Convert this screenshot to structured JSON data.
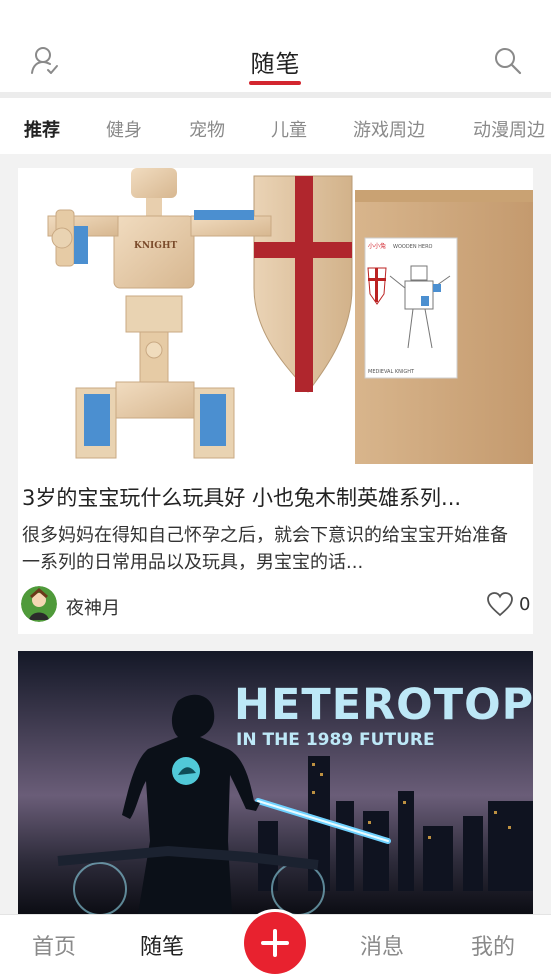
{
  "header": {
    "title": "随笔"
  },
  "icons": {
    "user": "user-check-icon",
    "search": "search-icon",
    "like": "heart-outline-icon",
    "add": "plus-icon"
  },
  "colors": {
    "accent": "#d3262f",
    "add_button": "#e8222f"
  },
  "tabs": [
    {
      "label": "推荐",
      "active": true
    },
    {
      "label": "健身",
      "active": false
    },
    {
      "label": "宠物",
      "active": false
    },
    {
      "label": "儿童",
      "active": false
    },
    {
      "label": "游戏周边",
      "active": false
    },
    {
      "label": "动漫周边",
      "active": false
    }
  ],
  "feed": [
    {
      "image_texts": {
        "robot_badge": "KNIGHT",
        "box_brand": "小小兔",
        "box_title": "WOODEN HERO",
        "box_caption": "MEDIEVAL KNIGHT"
      },
      "title": "3岁的宝宝玩什么玩具好 小也兔木制英雄系列...",
      "summary": "很多妈妈在得知自己怀孕之后，就会下意识的给宝宝开始准备一系列的日常用品以及玩具，男宝宝的话...",
      "author": "夜神月",
      "likes": "0"
    },
    {
      "image_texts": {
        "headline": "HETEROTOPIAS",
        "subheadline": "IN THE 1989 FUTURE"
      }
    }
  ],
  "bottom_nav": {
    "home": "首页",
    "essay": "随笔",
    "messages": "消息",
    "mine": "我的"
  }
}
